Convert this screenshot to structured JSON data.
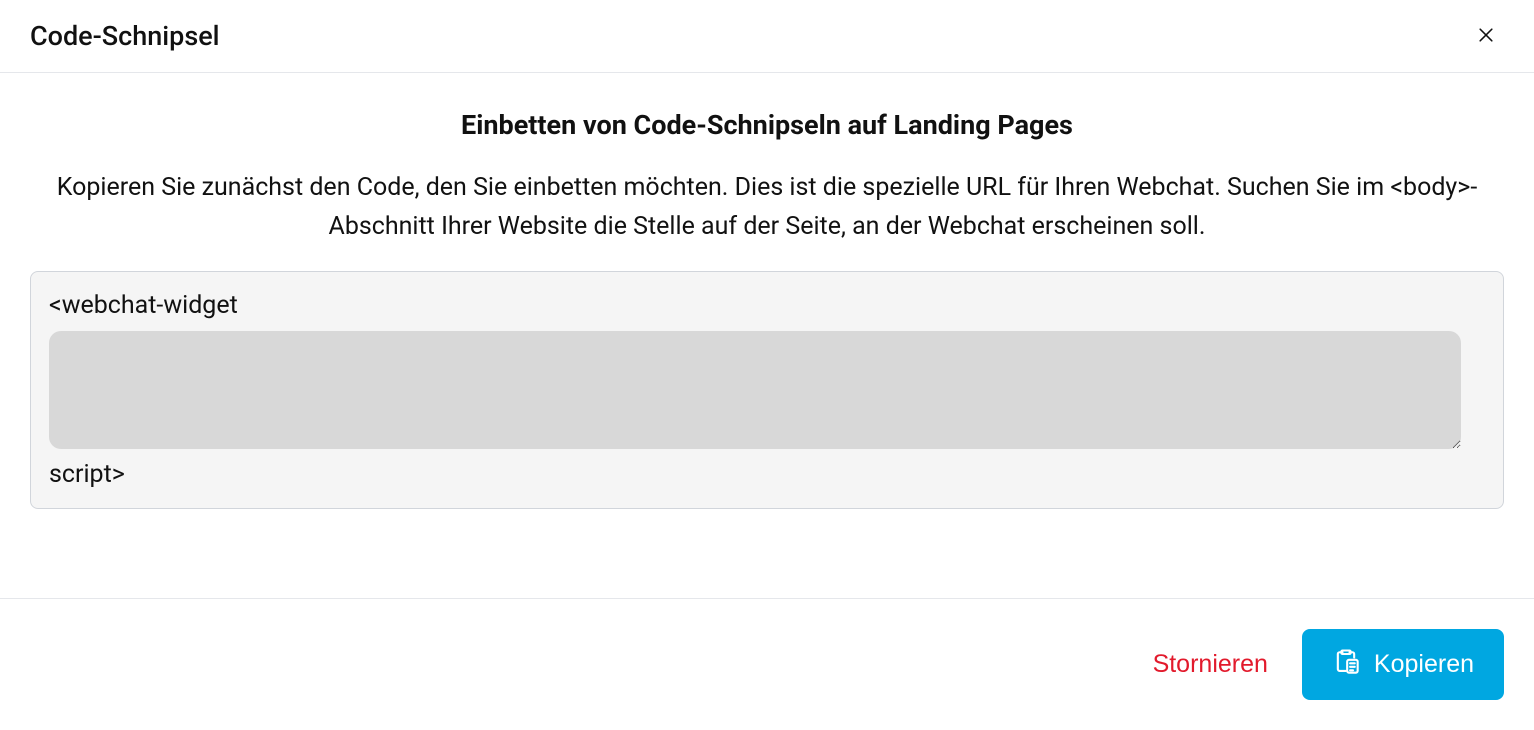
{
  "header": {
    "title": "Code-Schnipsel"
  },
  "body": {
    "heading": "Einbetten von Code-Schnipseln auf Landing Pages",
    "description": "Kopieren Sie zunächst den Code, den Sie einbetten möchten. Dies ist die spezielle URL für Ihren Webchat. Suchen Sie im <body>-Abschnitt Ihrer Website die Stelle auf der Seite, an der Webchat erscheinen soll.",
    "code_before": "<webchat-widget",
    "code_textarea_value": "",
    "code_after": "script>"
  },
  "footer": {
    "cancel_label": "Stornieren",
    "copy_label": "Kopieren"
  },
  "icons": {
    "close": "close-icon",
    "paste": "paste-icon"
  },
  "colors": {
    "accent": "#00a7e1",
    "danger": "#e21a2c",
    "code_bg": "#f5f5f5",
    "textarea_bg": "#d8d8d8"
  }
}
